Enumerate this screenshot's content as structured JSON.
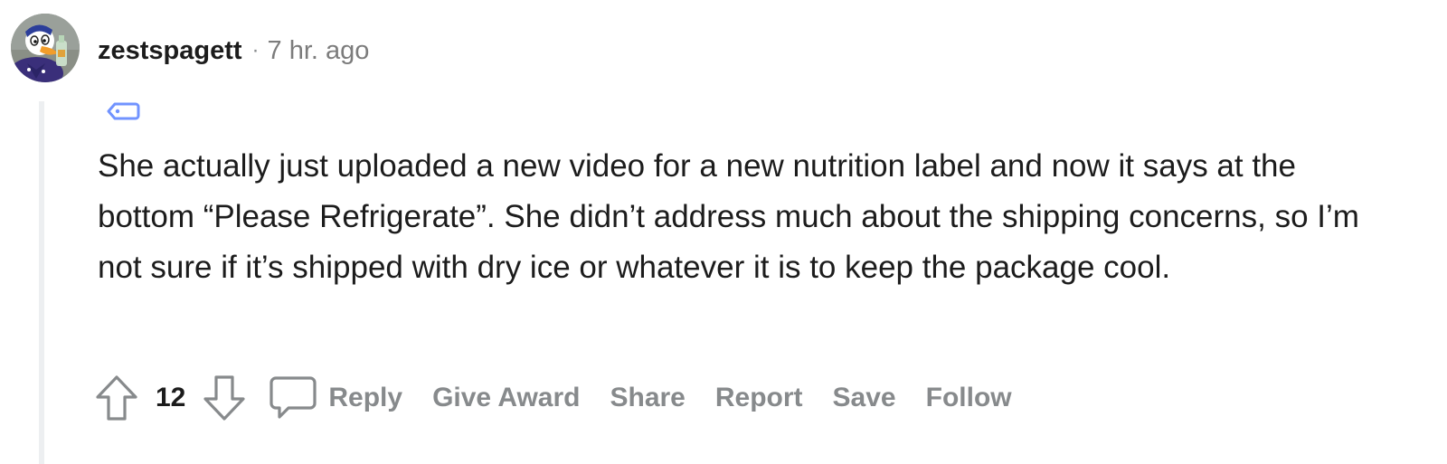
{
  "comment": {
    "username": "zestspagett",
    "separator": "·",
    "timestamp": "7 hr. ago",
    "avatar_icon": "duck-character-avatar",
    "flair_icon": "tag-icon",
    "body": "She actually just uploaded a new video for a new nutrition label and now it says at the bottom “Please Refrigerate”. She didn’t address much about the shipping concerns, so I’m not sure if it’s shipped with dry ice or whatever it is to keep the package cool.",
    "score": "12"
  },
  "actions": {
    "upvote_icon": "arrow-up-icon",
    "downvote_icon": "arrow-down-icon",
    "reply_icon": "speech-bubble-icon",
    "reply": "Reply",
    "give_award": "Give Award",
    "share": "Share",
    "report": "Report",
    "save": "Save",
    "follow": "Follow"
  },
  "colors": {
    "text_primary": "#1c1c1c",
    "text_muted": "#878a8c",
    "thread_line": "#edeff1",
    "flair_tag": "#7193ff"
  }
}
